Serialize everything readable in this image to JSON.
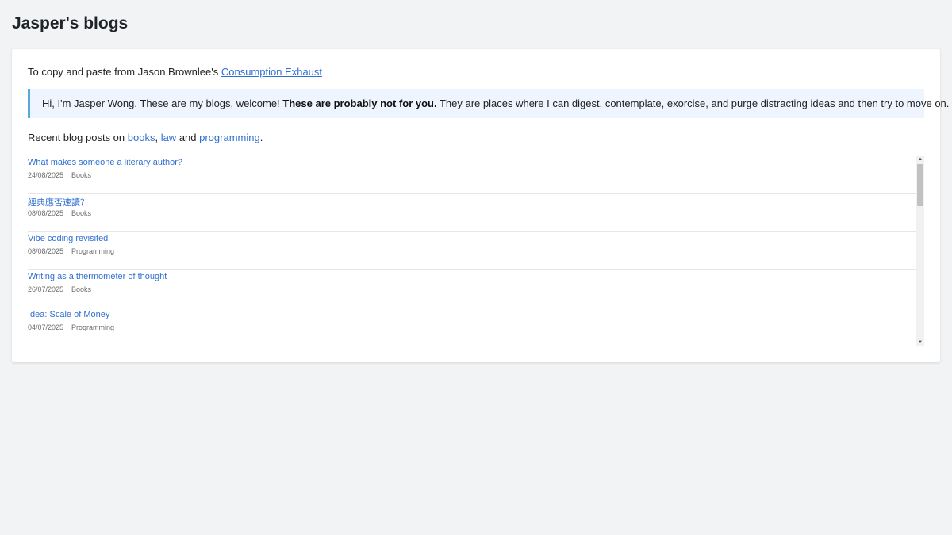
{
  "site": {
    "title": "Jasper's blogs"
  },
  "intro": {
    "text": "To copy and paste from Jason Brownlee's ",
    "link": "Consumption Exhaust"
  },
  "callout": {
    "pre": "Hi, I'm Jasper Wong. These are my blogs, welcome! ",
    "bold": "These are probably not for you.",
    "post": " They are places where I can digest, contemplate, exorcise, and purge distracting ideas and then try to move on."
  },
  "recent": {
    "prefix": "Recent blog posts on ",
    "link_books": "books",
    "sep1": ", ",
    "link_law": "law",
    "sep2": " and ",
    "link_programming": "programming",
    "suffix": "."
  },
  "posts": [
    {
      "title": "What makes someone a literary author?",
      "date": "24/08/2025",
      "tag": "Books"
    },
    {
      "title": "經典應否速讀？",
      "date": "08/08/2025",
      "tag": "Books"
    },
    {
      "title": "Vibe coding revisited",
      "date": "08/08/2025",
      "tag": "Programming"
    },
    {
      "title": "Writing as a thermometer of thought",
      "date": "26/07/2025",
      "tag": "Books"
    },
    {
      "title": "Idea: Scale of Money",
      "date": "04/07/2025",
      "tag": "Programming"
    }
  ],
  "icons": {
    "scroll_up": "scroll-up-arrow-icon",
    "scroll_down": "scroll-down-arrow-icon"
  },
  "colors": {
    "link": "#2f6fd1",
    "callout_border": "#5aa9dd",
    "callout_bg": "#eef5ff"
  }
}
